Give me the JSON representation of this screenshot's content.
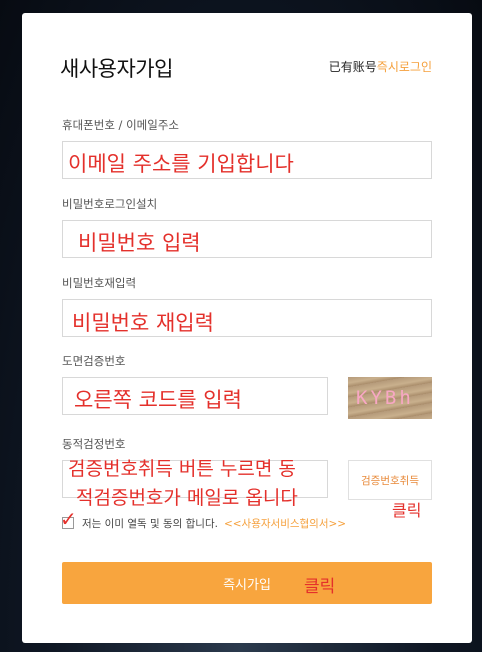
{
  "header": {
    "title": "새사용자가입",
    "login_prompt": "已有账号",
    "login_link": "즉시로그인"
  },
  "form": {
    "phone_email_label": "휴대폰번호 / 이메일주소",
    "password_label": "비밀번호로그인설치",
    "password_confirm_label": "비밀번호재입력",
    "captcha_label": "도면검증번호",
    "captcha_text": "KYBh",
    "sms_code_label": "동적검정번호",
    "get_code_button": "검증번호취득",
    "agree_text": "저는 이미 열독 및 동의 합니다.",
    "terms_link": "<<사용자서비스협의서>>",
    "submit_button": "즉시가입"
  },
  "annotations": {
    "email_hint": "이메일 주소를 기입합니다",
    "password_hint": "비밀번호 입력",
    "password_confirm_hint": "비밀번호 재입력",
    "captcha_hint": "오른쪽 코드를 입력",
    "sms_hint_line1": "검증번호취득  버튼 누르면 동",
    "sms_hint_line2": "적검증번호가 메일로 옵니다",
    "click_code": "클릭",
    "click_submit": "클릭",
    "check_mark": "✓"
  },
  "colors": {
    "accent": "#f8a53e",
    "annotation": "#e4302b"
  }
}
